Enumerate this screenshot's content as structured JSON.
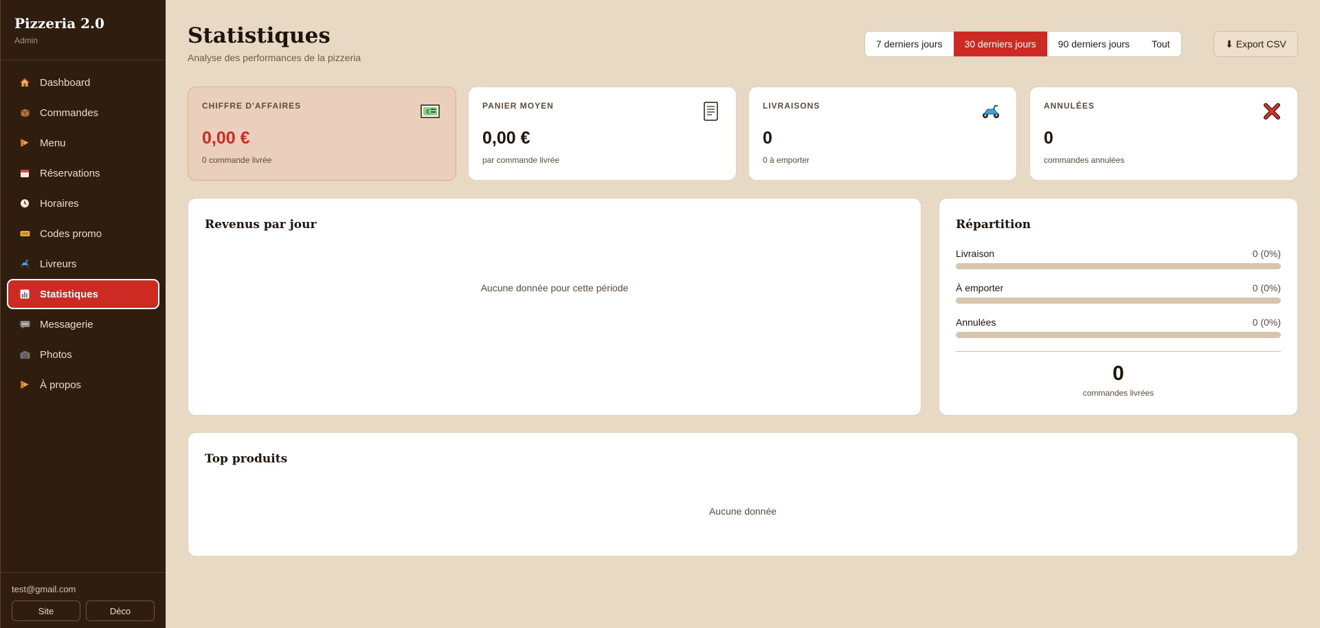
{
  "sidebar": {
    "brand": "Pizzeria 2.0",
    "role": "Admin",
    "items": [
      {
        "label": "Dashboard",
        "icon": "home-icon"
      },
      {
        "label": "Commandes",
        "icon": "box-icon"
      },
      {
        "label": "Menu",
        "icon": "pizza-icon"
      },
      {
        "label": "Réservations",
        "icon": "calendar-icon"
      },
      {
        "label": "Horaires",
        "icon": "clock-icon"
      },
      {
        "label": "Codes promo",
        "icon": "ticket-icon"
      },
      {
        "label": "Livreurs",
        "icon": "scooter-icon"
      },
      {
        "label": "Statistiques",
        "icon": "chart-icon",
        "active": true
      },
      {
        "label": "Messagerie",
        "icon": "chat-icon"
      },
      {
        "label": "Photos",
        "icon": "camera-icon"
      },
      {
        "label": "À propos",
        "icon": "pizza-icon"
      }
    ],
    "user_email": "test@gmail.com",
    "site_label": "Site",
    "logout_label": "Déco"
  },
  "header": {
    "title": "Statistiques",
    "subtitle": "Analyse des performances de la pizzeria",
    "ranges": [
      "7 derniers jours",
      "30 derniers jours",
      "90 derniers jours",
      "Tout"
    ],
    "active_range": "30 derniers jours",
    "export_label": "⬇ Export CSV"
  },
  "kpis": [
    {
      "label": "CHIFFRE D'AFFAIRES",
      "value": "0,00 €",
      "sub": "0 commande livrée",
      "icon": "cash-icon"
    },
    {
      "label": "PANIER MOYEN",
      "value": "0,00 €",
      "sub": "par commande livrée",
      "icon": "receipt-icon"
    },
    {
      "label": "LIVRAISONS",
      "value": "0",
      "sub": "0 à emporter",
      "icon": "scooter-icon"
    },
    {
      "label": "ANNULÉES",
      "value": "0",
      "sub": "commandes annulées",
      "icon": "cross-icon"
    }
  ],
  "revenue": {
    "title": "Revenus par jour",
    "empty": "Aucune donnée pour cette période"
  },
  "repartition": {
    "title": "Répartition",
    "rows": [
      {
        "label": "Livraison",
        "value": "0 (0%)",
        "fraction": 0
      },
      {
        "label": "À emporter",
        "value": "0 (0%)",
        "fraction": 0
      },
      {
        "label": "Annulées",
        "value": "0 (0%)",
        "fraction": 0
      }
    ],
    "total": "0",
    "total_label": "commandes livrées"
  },
  "top_products": {
    "title": "Top produits",
    "empty": "Aucune donnée"
  },
  "colors": {
    "accent": "#cc2a22",
    "sidebar_bg": "#2f1d10",
    "page_bg": "#e8d9c4"
  }
}
